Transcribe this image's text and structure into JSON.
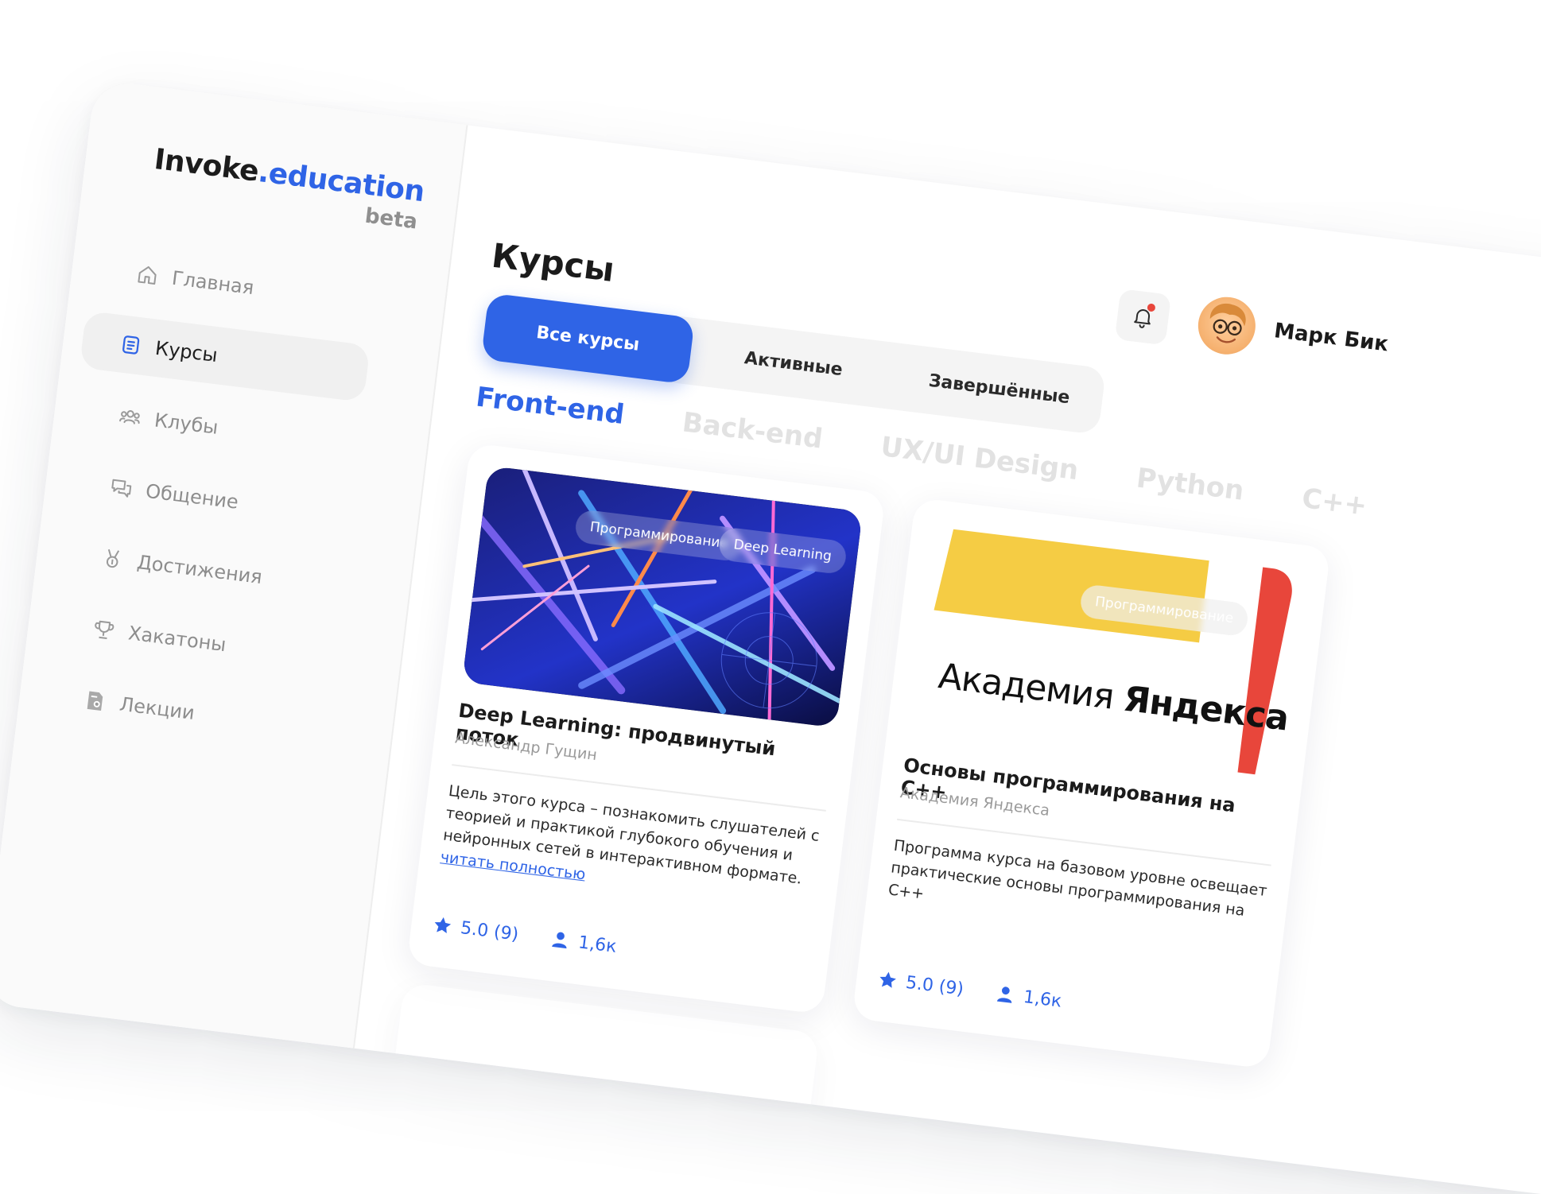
{
  "brand": {
    "name_main": "Invoke",
    "name_accent": ".education",
    "tag": "beta"
  },
  "sidebar": {
    "items": [
      {
        "label": "Главная",
        "icon": "home-icon",
        "active": false
      },
      {
        "label": "Курсы",
        "icon": "document-icon",
        "active": true
      },
      {
        "label": "Клубы",
        "icon": "users-icon",
        "active": false
      },
      {
        "label": "Общение",
        "icon": "chat-icon",
        "active": false
      },
      {
        "label": "Достижения",
        "icon": "medal-icon",
        "active": false
      },
      {
        "label": "Хакатоны",
        "icon": "trophy-icon",
        "active": false
      },
      {
        "label": "Лекции",
        "icon": "lecture-icon",
        "active": false
      }
    ]
  },
  "header": {
    "title": "Курсы",
    "notifications": {
      "icon": "bell-icon",
      "has_unread": true
    },
    "user": {
      "name": "Марк Бик",
      "avatar": "memoji-avatar"
    }
  },
  "tabs": [
    {
      "label": "Все курсы",
      "active": true
    },
    {
      "label": "Активные",
      "active": false
    },
    {
      "label": "Завершённые",
      "active": false
    }
  ],
  "categories": [
    {
      "label": "Front-end",
      "active": true
    },
    {
      "label": "Back-end",
      "active": false
    },
    {
      "label": "UX/UI Design",
      "active": false
    },
    {
      "label": "Python",
      "active": false
    },
    {
      "label": "C++",
      "active": false
    }
  ],
  "courses": [
    {
      "tags": [
        "Программирование",
        "Deep Learning"
      ],
      "title": "Deep Learning: продвинутый поток",
      "author": "Александр Гущин",
      "description": "Цель этого курса – познакомить слушателей с теорией и практикой глубокого обучения и нейронных сетей в интерактивном формате.",
      "read_more": "читать полностью",
      "rating": "5.0 (9)",
      "students": "1,6к"
    },
    {
      "tags": [
        "Программирование"
      ],
      "logo_text": "Академия",
      "logo_text_bold": "Яндекса",
      "title": "Основы программирования на С++",
      "author": "Академия Яндекса",
      "description": "Программа курса на базовом уровне освещает практические основы программирования на С++",
      "rating": "5.0 (9)",
      "students": "1,6к"
    }
  ],
  "colors": {
    "accent": "#2f64e6",
    "notification_dot": "#e8463b",
    "yandex_yellow": "#f5cc44",
    "yandex_red": "#e8463b"
  }
}
